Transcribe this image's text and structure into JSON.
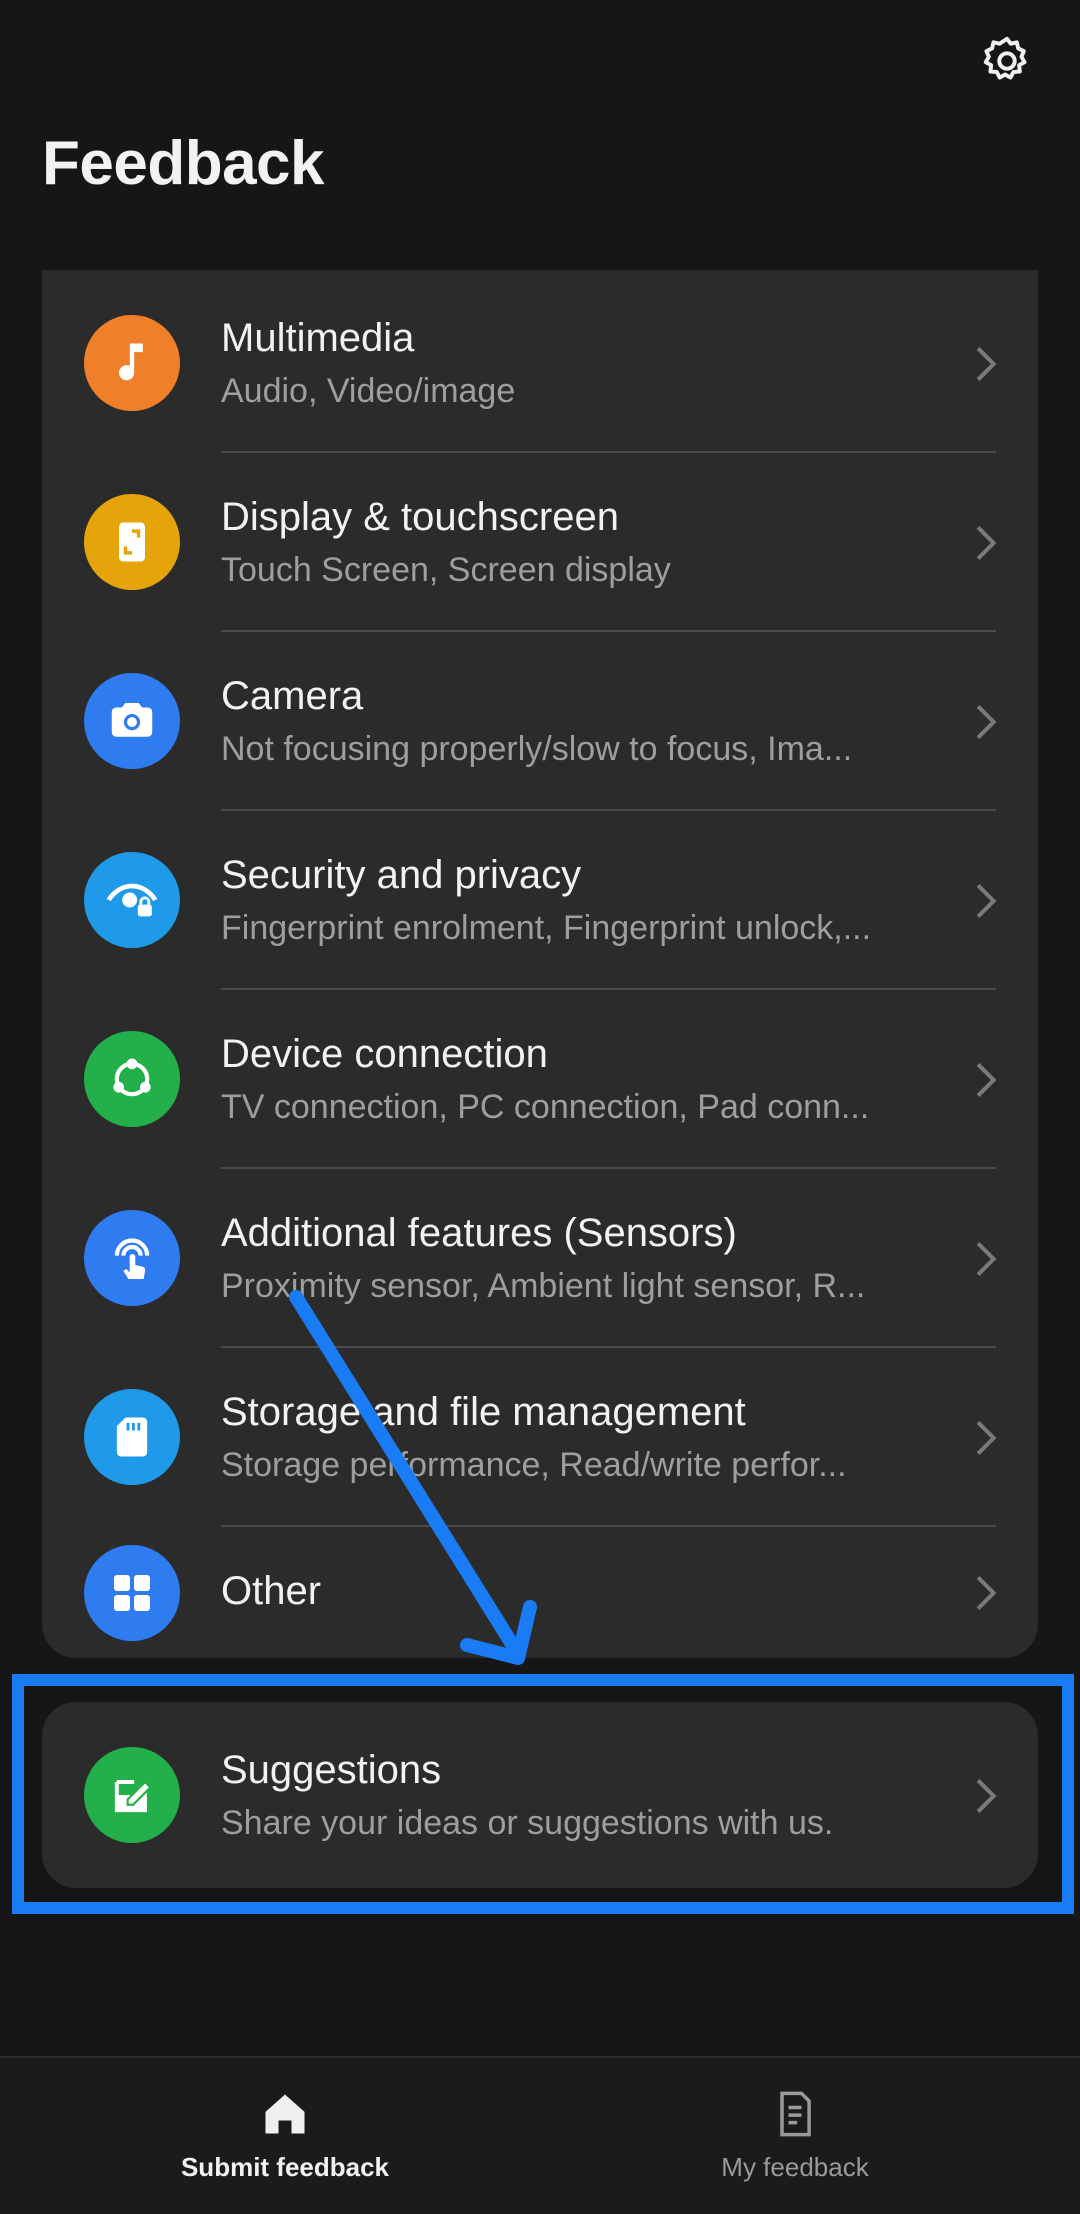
{
  "header": {
    "title": "Feedback",
    "settings_icon": "gear-icon"
  },
  "categories": [
    {
      "title": "Multimedia",
      "subtitle": "Audio, Video/image",
      "icon": "music-note-icon",
      "color": "#f07f2a"
    },
    {
      "title": "Display & touchscreen",
      "subtitle": "Touch Screen, Screen display",
      "icon": "phone-screen-icon",
      "color": "#e5a50a"
    },
    {
      "title": "Camera",
      "subtitle": "Not focusing properly/slow to focus, Ima...",
      "icon": "camera-icon",
      "color": "#2f7bf0"
    },
    {
      "title": "Security and privacy",
      "subtitle": "Fingerprint enrolment, Fingerprint unlock,...",
      "icon": "privacy-eye-lock-icon",
      "color": "#1f9ae8"
    },
    {
      "title": "Device connection",
      "subtitle": "TV connection, PC connection, Pad conn...",
      "icon": "share-nodes-icon",
      "color": "#23b04a"
    },
    {
      "title": "Additional features (Sensors)",
      "subtitle": "Proximity sensor, Ambient light sensor, R...",
      "icon": "touch-sensor-icon",
      "color": "#2f7bf0"
    },
    {
      "title": "Storage and file management",
      "subtitle": "Storage performance, Read/write perfor...",
      "icon": "sd-card-icon",
      "color": "#1f9ae8"
    },
    {
      "title": "Other",
      "subtitle": "",
      "icon": "grid-apps-icon",
      "color": "#2f7bf0"
    }
  ],
  "suggestion": {
    "title": "Suggestions",
    "subtitle": "Share your ideas or suggestions with us.",
    "icon": "edit-note-icon",
    "color": "#23b04a"
  },
  "annotation": {
    "color": "#1a7cf5"
  },
  "bottom_nav": [
    {
      "label": "Submit feedback",
      "icon": "home-icon",
      "active": true
    },
    {
      "label": "My feedback",
      "icon": "document-icon",
      "active": false
    }
  ]
}
